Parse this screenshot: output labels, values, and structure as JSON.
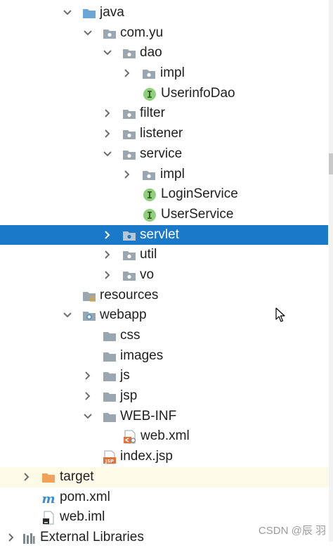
{
  "tree": [
    {
      "label": "java",
      "expanded": true,
      "icon": "folder-blue"
    },
    {
      "label": "com.yu",
      "expanded": true,
      "icon": "package"
    },
    {
      "label": "dao",
      "expanded": true,
      "icon": "package"
    },
    {
      "label": "impl",
      "expanded": false,
      "icon": "package"
    },
    {
      "label": "UserinfoDao",
      "icon": "interface"
    },
    {
      "label": "filter",
      "expanded": false,
      "icon": "package"
    },
    {
      "label": "listener",
      "expanded": false,
      "icon": "package"
    },
    {
      "label": "service",
      "expanded": true,
      "icon": "package"
    },
    {
      "label": "impl",
      "expanded": false,
      "icon": "package"
    },
    {
      "label": "LoginService",
      "icon": "interface"
    },
    {
      "label": "UserService",
      "icon": "interface"
    },
    {
      "label": "servlet",
      "expanded": false,
      "icon": "package",
      "selected": true
    },
    {
      "label": "util",
      "expanded": false,
      "icon": "package"
    },
    {
      "label": "vo",
      "expanded": false,
      "icon": "package"
    },
    {
      "label": "resources",
      "icon": "resources-folder"
    },
    {
      "label": "webapp",
      "expanded": true,
      "icon": "web-folder"
    },
    {
      "label": "css",
      "icon": "folder-gray"
    },
    {
      "label": "images",
      "icon": "folder-gray"
    },
    {
      "label": "js",
      "expanded": false,
      "icon": "folder-gray"
    },
    {
      "label": "jsp",
      "expanded": false,
      "icon": "folder-gray"
    },
    {
      "label": "WEB-INF",
      "expanded": true,
      "icon": "folder-gray"
    },
    {
      "label": "web.xml",
      "icon": "xml-file"
    },
    {
      "label": "index.jsp",
      "icon": "jsp-file"
    },
    {
      "label": "target",
      "expanded": false,
      "icon": "folder-orange",
      "highlight": true
    },
    {
      "label": "pom.xml",
      "icon": "maven-file"
    },
    {
      "label": "web.iml",
      "icon": "iml-file"
    },
    {
      "label": "External Libraries",
      "expanded": false,
      "icon": "libraries"
    }
  ],
  "watermark": "CSDN @辰 羽",
  "colors": {
    "selection": "#1a79c8",
    "folder_blue": "#6aa6d6",
    "folder_gray": "#9aa7b0",
    "folder_orange": "#f0a15a",
    "interface_green": "#8fce7a",
    "row_highlight": "#fdfbe8"
  }
}
